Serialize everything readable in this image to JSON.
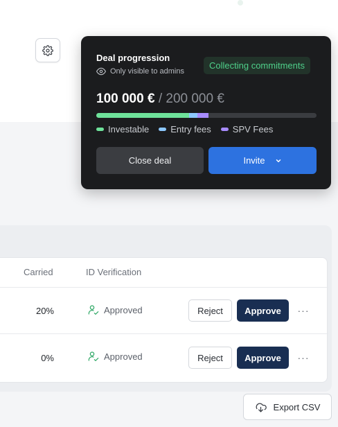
{
  "deal": {
    "title": "Deal progression",
    "visibility_note": "Only visible to admins",
    "status": "Collecting commitments",
    "raised": "100 000 €",
    "separator": "/",
    "target": "200 000 €",
    "progress": {
      "investable_fraction": 0.42,
      "entry_fees_fraction": 0.04,
      "spv_fees_fraction": 0.05
    },
    "legend": [
      {
        "label": "Investable",
        "color": "#6ee29a"
      },
      {
        "label": "Entry fees",
        "color": "#8cc8ff"
      },
      {
        "label": "SPV Fees",
        "color": "#a88cff"
      }
    ],
    "close_label": "Close deal",
    "invite_label": "Invite"
  },
  "table": {
    "headers": {
      "carried": "Carried",
      "id_verification": "ID Verification"
    },
    "rows": [
      {
        "carried": "20%",
        "verification": "Approved",
        "reject": "Reject",
        "approve": "Approve",
        "more": "···"
      },
      {
        "carried": "0%",
        "verification": "Approved",
        "reject": "Reject",
        "approve": "Approve",
        "more": "···"
      }
    ]
  },
  "export_label": "Export CSV",
  "colors": {
    "accent_blue": "#2d72e0",
    "approve_navy": "#192e52",
    "status_green": "#4fd08a"
  }
}
